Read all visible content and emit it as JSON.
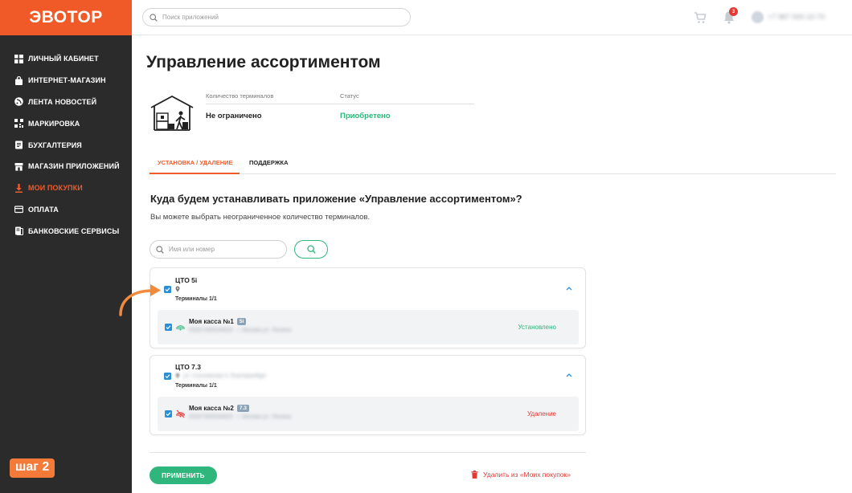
{
  "brand": {
    "logo": "ЭВОТОР",
    "accent": "#f05a28",
    "green": "#2fb67c",
    "red": "#e53935",
    "checkbox": "#2a8fd6"
  },
  "header": {
    "search_placeholder": "Поиск приложений",
    "notifications_count": "3",
    "phone": "+7 987 000-10-70"
  },
  "sidebar": {
    "items": [
      {
        "label": "ЛИЧНЫЙ КАБИНЕТ",
        "icon": "grid-icon"
      },
      {
        "label": "ИНТЕРНЕТ-МАГАЗИН",
        "icon": "bag-icon"
      },
      {
        "label": "ЛЕНТА НОВОСТЕЙ",
        "icon": "news-icon"
      },
      {
        "label": "МАРКИРОВКА",
        "icon": "barcode-icon"
      },
      {
        "label": "БУХГАЛТЕРИЯ",
        "icon": "document-icon"
      },
      {
        "label": "МАГАЗИН ПРИЛОЖЕНИЙ",
        "icon": "store-icon"
      },
      {
        "label": "МОИ ПОКУПКИ",
        "icon": "download-icon",
        "active": true
      },
      {
        "label": "ОПЛАТА",
        "icon": "card-icon"
      },
      {
        "label": "БАНКОВСКИЕ СЕРВИСЫ",
        "icon": "bank-icon"
      }
    ],
    "step_label": "шаг 2"
  },
  "main": {
    "title": "Управление ассортиментом",
    "meta": {
      "terminals_label": "Количество терминалов",
      "terminals_value": "Не ограничено",
      "status_label": "Статус",
      "status_value": "Приобретено"
    },
    "tabs": [
      {
        "label": "УСТАНОВКА / УДАЛЕНИЕ",
        "active": true
      },
      {
        "label": "ПОДДЕРЖКА",
        "active": false
      }
    ],
    "question_title": "Куда будем устанавливать приложение «Управление ассортиментом»?",
    "question_sub": "Вы можете выбрать неограниченное количество терминалов.",
    "filter_placeholder": "Имя или номер",
    "groups": [
      {
        "title": "ЦТО 5i",
        "address": "",
        "terminals": "Терминалы 1/1",
        "kassa": {
          "name": "Моя касса №1",
          "badge": "5i",
          "serial": "00307300034829",
          "meta": "г. Москва ул. Ленина",
          "status": "Установлено"
        }
      },
      {
        "title": "ЦТО 7.3",
        "address": "ул. Сосновская 4, Екатеринбург",
        "terminals": "Терминалы 1/1",
        "kassa": {
          "name": "Моя касса №2",
          "badge": "7.3",
          "serial": "00307300034829",
          "meta": "г. Москва ул. Ленина",
          "status": "Удаление"
        }
      }
    ],
    "apply_label": "ПРИМЕНИТЬ",
    "delete_label": "Удалить из «Моих покупок»"
  }
}
